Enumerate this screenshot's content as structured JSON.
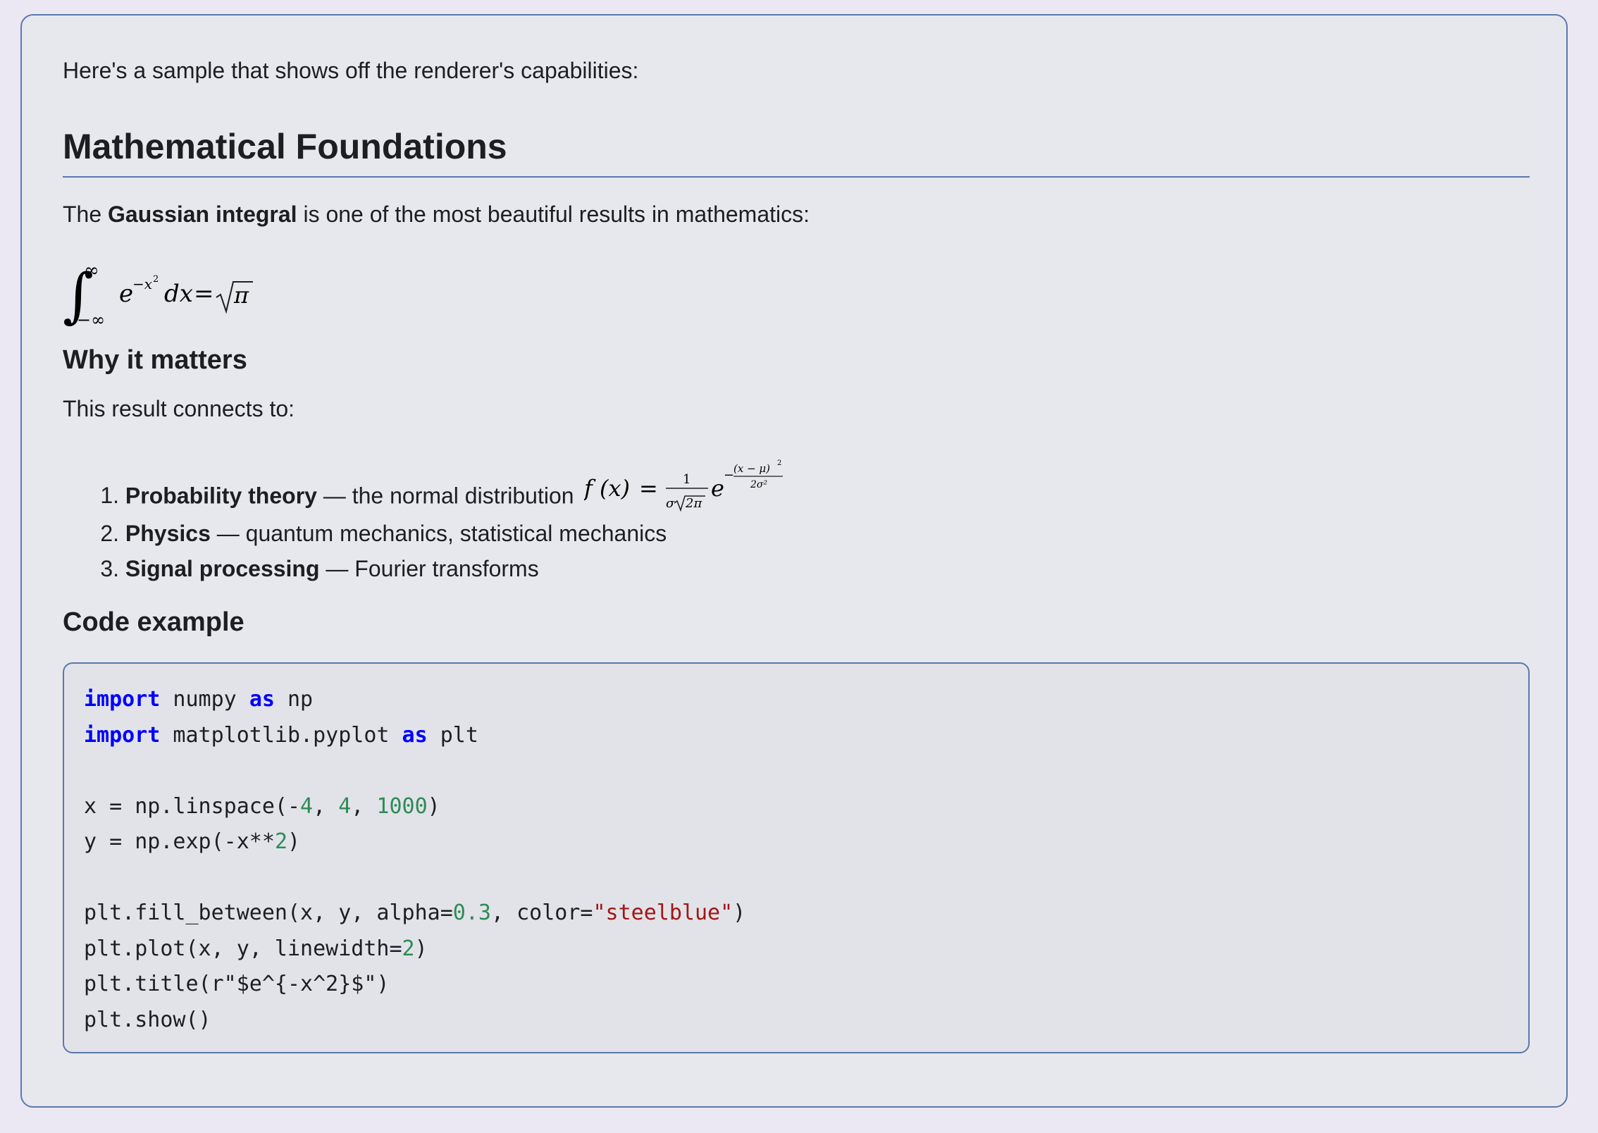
{
  "intro": "Here's a sample that shows off the renderer's capabilities:",
  "heading": "Mathematical Foundations",
  "gauss_para": {
    "before": "The ",
    "bold": "Gaussian integral",
    "after": " is one of the most beautiful results in mathematics:"
  },
  "display_math": {
    "upper": "∞",
    "lower": "−∞",
    "integrand_base": "e",
    "integrand_exp": "−x",
    "integrand_exp_sq": "2",
    "dx": "dx",
    "equals": "=",
    "rhs": "π"
  },
  "why_heading": "Why it matters",
  "connects": "This result connects to:",
  "list": [
    {
      "num": "1.",
      "bold": "Probability theory",
      "text": " — the normal distribution "
    },
    {
      "num": "2.",
      "bold": "Physics",
      "text": " — quantum mechanics, statistical mechanics"
    },
    {
      "num": "3.",
      "bold": "Signal processing",
      "text": " — Fourier transforms"
    }
  ],
  "normal_math": {
    "lhs": "f (x)",
    "equals": "=",
    "num": "1",
    "den_sigma": "σ",
    "den_root": "2π",
    "base": "e",
    "exp_minus": "−",
    "exp_num": "(x − μ)",
    "exp_num_sq": "2",
    "exp_den": "2σ²"
  },
  "code_heading": "Code example",
  "code_lines": [
    [
      {
        "t": "import",
        "c": "kw"
      },
      {
        "t": " numpy "
      },
      {
        "t": "as",
        "c": "kw"
      },
      {
        "t": " np"
      }
    ],
    [
      {
        "t": "import",
        "c": "kw"
      },
      {
        "t": " matplotlib.pyplot "
      },
      {
        "t": "as",
        "c": "kw"
      },
      {
        "t": " plt"
      }
    ],
    [],
    [
      {
        "t": "x = np.linspace(-"
      },
      {
        "t": "4",
        "c": "nm"
      },
      {
        "t": ", "
      },
      {
        "t": "4",
        "c": "nm"
      },
      {
        "t": ", "
      },
      {
        "t": "1000",
        "c": "nm"
      },
      {
        "t": ")"
      }
    ],
    [
      {
        "t": "y = np.exp(-x**"
      },
      {
        "t": "2",
        "c": "nm"
      },
      {
        "t": ")"
      }
    ],
    [],
    [
      {
        "t": "plt.fill_between(x, y, alpha="
      },
      {
        "t": "0.3",
        "c": "nm"
      },
      {
        "t": ", color="
      },
      {
        "t": "\"steelblue\"",
        "c": "st"
      },
      {
        "t": ")"
      }
    ],
    [
      {
        "t": "plt.plot(x, y, linewidth="
      },
      {
        "t": "2",
        "c": "nm"
      },
      {
        "t": ")"
      }
    ],
    [
      {
        "t": "plt.title(r\"$e^{-x^2}$\")"
      }
    ],
    [
      {
        "t": "plt.show()"
      }
    ]
  ],
  "colors": {
    "keyword": "#0000ff",
    "number": "#2e8b57",
    "string": "#a31515",
    "border": "#5b78ad"
  }
}
